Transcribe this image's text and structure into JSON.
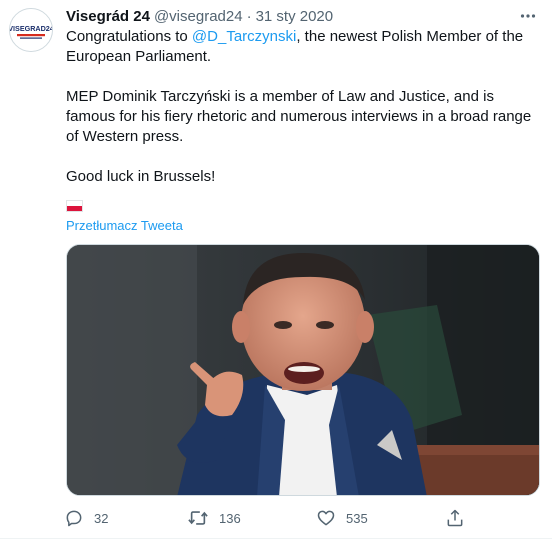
{
  "tweet": {
    "avatar_text": "VISEGRAD24",
    "display_name": "Visegrád 24",
    "handle": "@visegrad24",
    "separator": "·",
    "timestamp": "31 sty 2020",
    "text": {
      "line1_prefix": "Congratulations to ",
      "mention": "@D_Tarczynski",
      "line1_suffix": ", the newest Polish Member of the European Parliament.",
      "paragraph2": "MEP Dominik Tarczyński is a member of Law and Justice, and is famous for his fiery rhetoric and numerous interviews in a broad range of Western press.",
      "paragraph3": "Good luck in Brussels!"
    },
    "flag_icon": "poland-flag-icon",
    "translate_label": "Przetłumacz Tweeta",
    "media_icon": "photo-man-pointing",
    "stats": {
      "replies": "32",
      "retweets": "136",
      "likes": "535"
    }
  },
  "colors": {
    "accent": "#1d9bf0",
    "muted": "#536471",
    "text": "#0f1419",
    "avatar_brand": "#1b2f6b",
    "avatar_red": "#d52b1e"
  }
}
